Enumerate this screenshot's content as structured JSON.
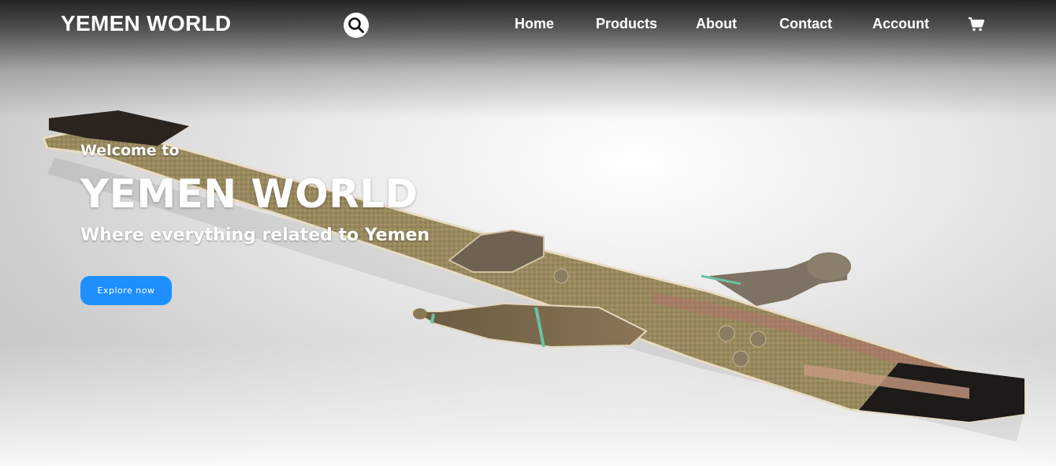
{
  "brand": {
    "name": "YEMEN WORLD"
  },
  "nav": {
    "items": [
      {
        "label": "Home"
      },
      {
        "label": "Products"
      },
      {
        "label": "About"
      },
      {
        "label": "Contact"
      },
      {
        "label": "Account"
      }
    ],
    "search_icon": "search-icon",
    "cart_icon": "cart-icon"
  },
  "hero": {
    "welcome": "Welcome to",
    "title": "YEMEN WORLD",
    "tagline": "Where everything related to Yemen",
    "cta_label": "Explore now"
  },
  "colors": {
    "cta": "#1e8fff",
    "text": "#ffffff"
  }
}
